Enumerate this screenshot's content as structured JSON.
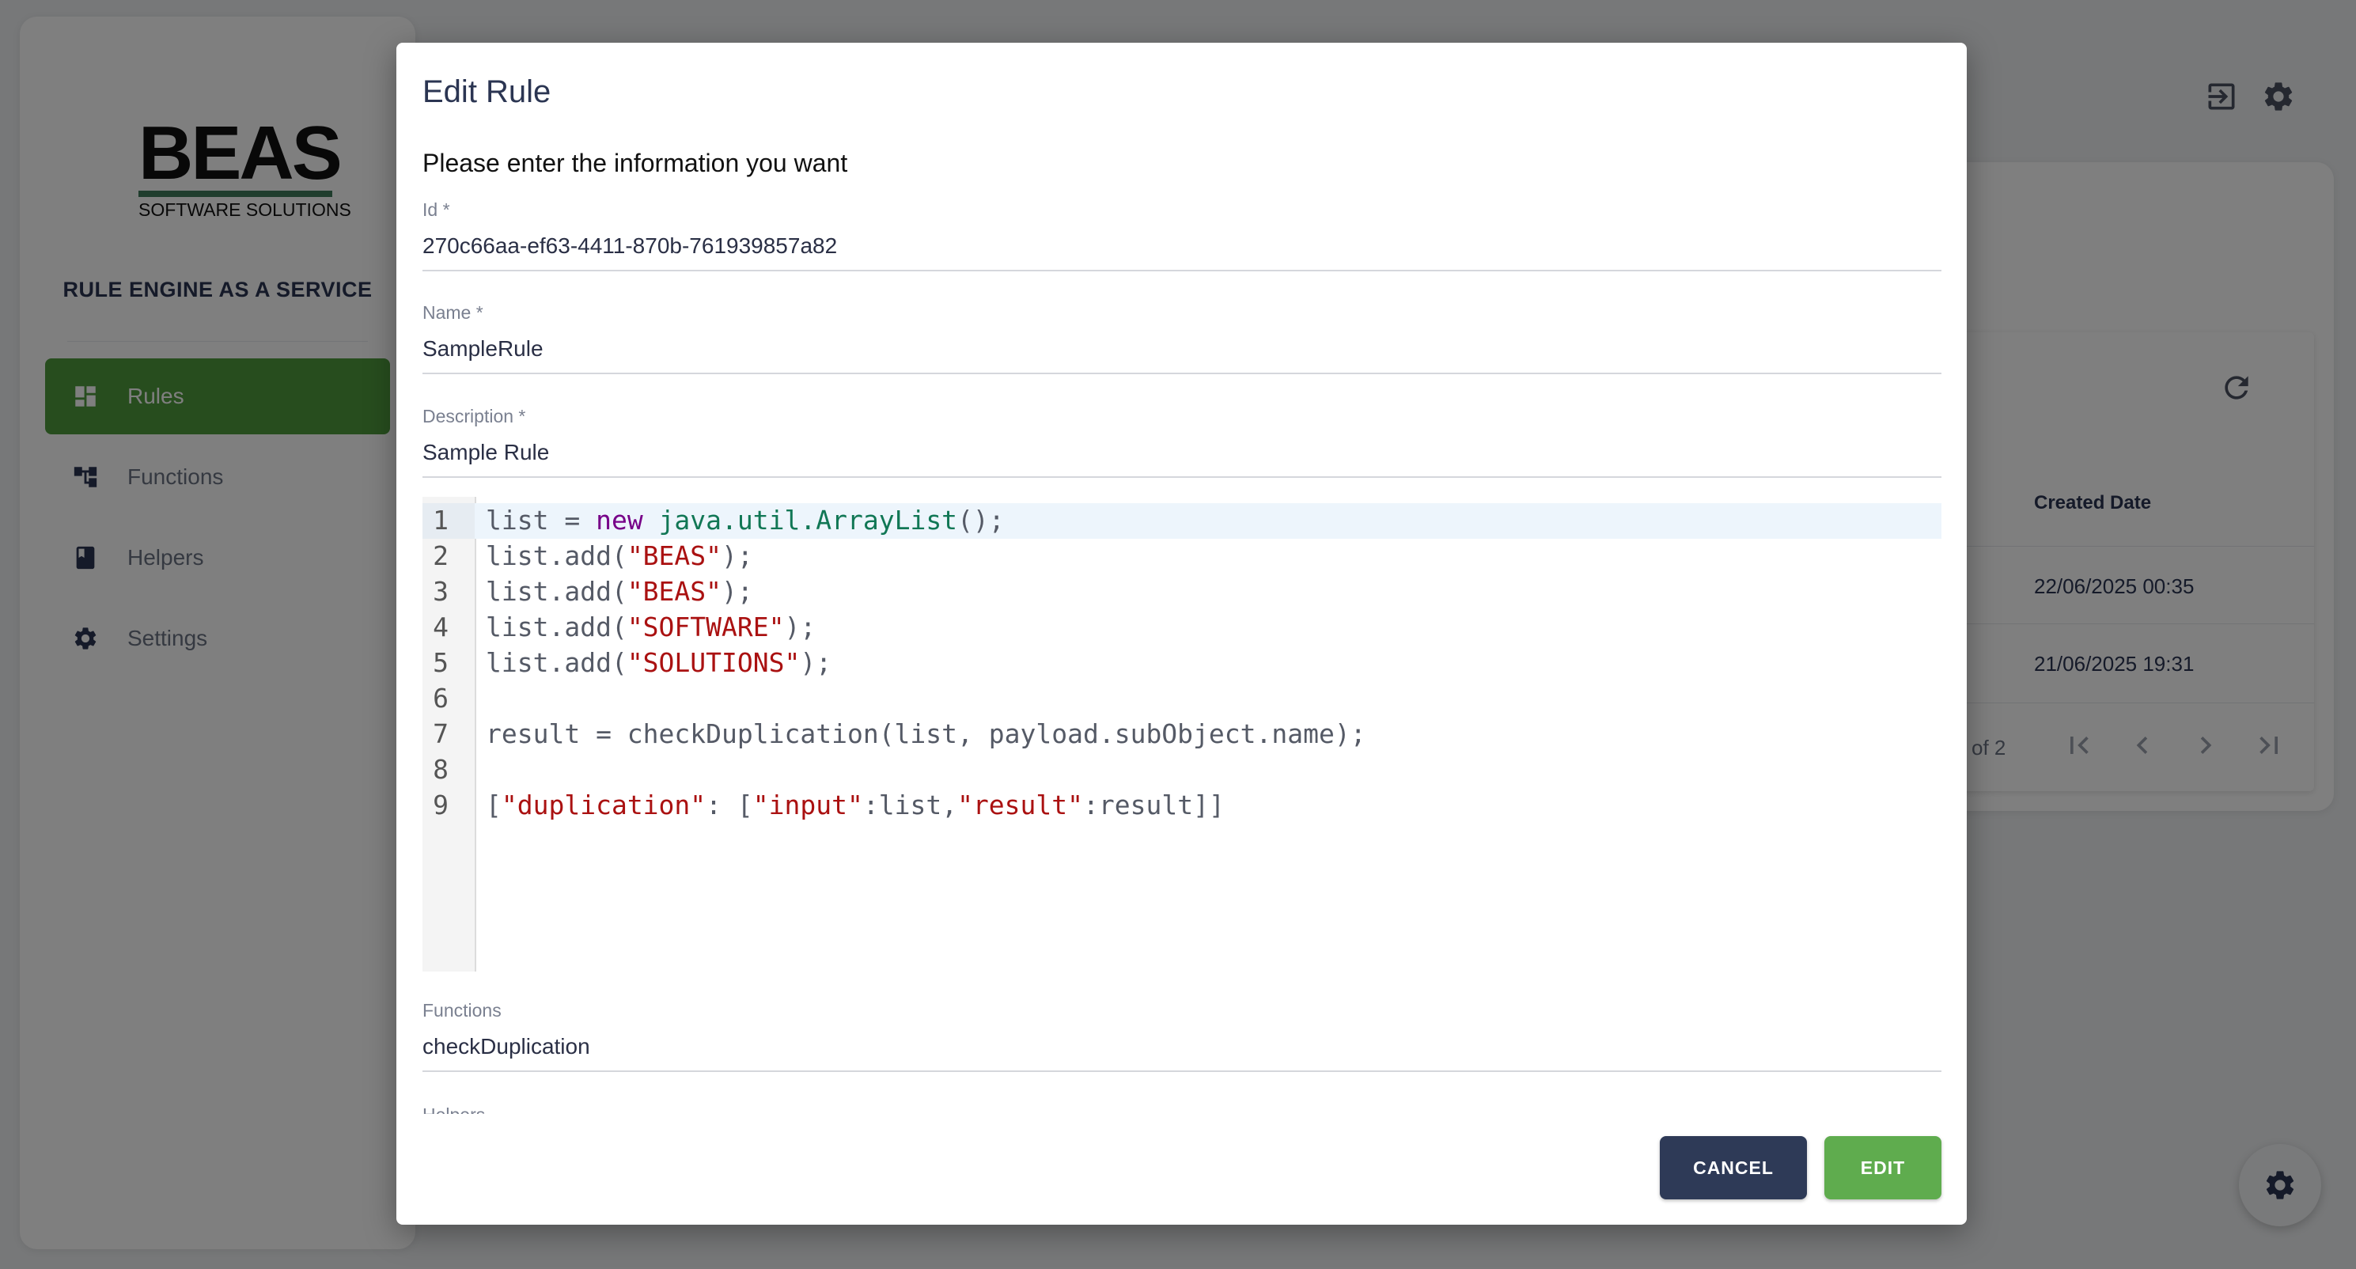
{
  "brand": {
    "logo_main": "BEAS",
    "logo_sub": "SOFTWARE SOLUTIONS",
    "app_subtitle": "RULE ENGINE AS A SERVICE"
  },
  "sidebar": {
    "items": [
      {
        "label": "Rules",
        "icon": "dashboard-icon",
        "active": true
      },
      {
        "label": "Functions",
        "icon": "tree-icon",
        "active": false
      },
      {
        "label": "Helpers",
        "icon": "book-icon",
        "active": false
      },
      {
        "label": "Settings",
        "icon": "gear-icon",
        "active": false
      }
    ]
  },
  "topbar": {
    "icons": [
      "logout-icon",
      "gear-icon"
    ]
  },
  "table": {
    "column_header": "Created Date",
    "rows": [
      "22/06/2025 00:35",
      "21/06/2025 19:31"
    ],
    "pagination_text": "of 2"
  },
  "dialog": {
    "title": "Edit Rule",
    "subtitle": "Please enter the information you want",
    "fields": {
      "id": {
        "label": "Id *",
        "value": "270c66aa-ef63-4411-870b-761939857a82"
      },
      "name": {
        "label": "Name *",
        "value": "SampleRule"
      },
      "description": {
        "label": "Description *",
        "value": "Sample Rule"
      },
      "functions": {
        "label": "Functions",
        "value": "checkDuplication"
      },
      "helpers": {
        "label": "Helpers"
      }
    },
    "code": {
      "line_numbers": [
        "1",
        "2",
        "3",
        "4",
        "5",
        "6",
        "7",
        "8",
        "9"
      ],
      "lines": [
        "list = new java.util.ArrayList();",
        "list.add(\"BEAS\");",
        "list.add(\"BEAS\");",
        "list.add(\"SOFTWARE\");",
        "list.add(\"SOLUTIONS\");",
        "",
        "result = checkDuplication(list, payload.subObject.name);",
        "",
        "[\"duplication\": [\"input\":list,\"result\":result]]"
      ]
    },
    "buttons": {
      "cancel": "CANCEL",
      "edit": "EDIT"
    }
  },
  "colors": {
    "accent_green": "#5fac4e",
    "nav_active": "#4e9a3d",
    "cancel_navy": "#2e3a57",
    "code_keyword": "#770088",
    "code_class": "#117755",
    "code_string": "#aa1111"
  }
}
